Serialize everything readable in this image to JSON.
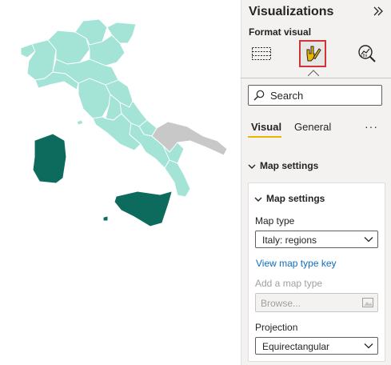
{
  "map": {
    "colors": {
      "regions": "#a3e4d7",
      "highlighted": "#0d6b5e",
      "no_data": "#c8c8c8",
      "border": "#ffffff"
    }
  },
  "pane": {
    "title": "Visualizations",
    "collapse_icon": "chevron-double-right-icon",
    "format_label": "Format visual",
    "icon_buttons": [
      {
        "name": "build-visual-icon",
        "selected": false
      },
      {
        "name": "format-visual-icon",
        "selected": true
      },
      {
        "name": "analytics-icon",
        "selected": false
      }
    ],
    "search_placeholder": "Search",
    "tabs": [
      {
        "label": "Visual",
        "active": true
      },
      {
        "label": "General",
        "active": false
      }
    ],
    "more_label": "···",
    "section_title": "Map settings",
    "card": {
      "title": "Map settings",
      "map_type_label": "Map type",
      "map_type_value": "Italy: regions",
      "link": "View map type key",
      "add_map_label": "Add a map type",
      "browse_placeholder": "Browse...",
      "projection_label": "Projection",
      "projection_value": "Equirectangular"
    },
    "accent_color": "#e8b700",
    "selection_color": "#d13438"
  }
}
